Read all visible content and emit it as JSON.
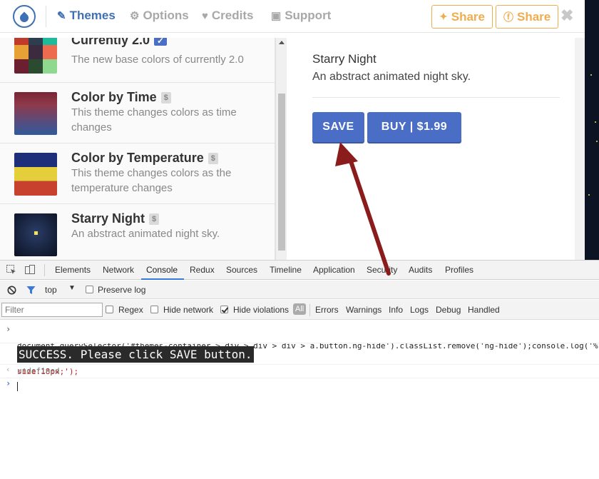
{
  "nav": {
    "themes": "Themes",
    "options": "Options",
    "credits": "Credits",
    "support": "Support",
    "share_twitter": "Share",
    "share_facebook": "Share",
    "close": "✖"
  },
  "themes": [
    {
      "name": "Currently 2.0",
      "desc": "The new base colors of currently 2.0",
      "badge": "✓"
    },
    {
      "name": "Color by Time",
      "desc": "This theme changes colors as time changes",
      "badge": "$"
    },
    {
      "name": "Color by Temperature",
      "desc": "This theme changes colors as the temperature changes",
      "badge": "$"
    },
    {
      "name": "Starry Night",
      "desc": "An abstract animated night sky.",
      "badge": "$"
    }
  ],
  "detail": {
    "title": "Starry Night",
    "desc": "An abstract animated night sky.",
    "save": "SAVE",
    "buy": "BUY | $1.99"
  },
  "devtools": {
    "tabs": [
      "Elements",
      "Network",
      "Console",
      "Redux",
      "Sources",
      "Timeline",
      "Application",
      "Security",
      "Audits",
      "Profiles"
    ],
    "active_tab": "Console",
    "context": "top",
    "preserve_log": "Preserve log",
    "filter_placeholder": "Filter",
    "regex": "Regex",
    "hide_network": "Hide network",
    "hide_violations": "Hide violations",
    "levels": [
      "All",
      "Errors",
      "Warnings",
      "Info",
      "Logs",
      "Debug",
      "Handled"
    ],
    "command_line1": "document.querySelector('#themes-container > div > div > div > a.button.ng-hide').classList.remove('ng-hide');console.log('%",
    "command_line2": "size:18px;');",
    "success": "SUCCESS. Please click SAVE button.",
    "result": "undefined"
  },
  "colors": {
    "brand_blue": "#4a6dc6",
    "share_orange": "#f0ad4e",
    "annotation_red": "#8b1c1c"
  }
}
